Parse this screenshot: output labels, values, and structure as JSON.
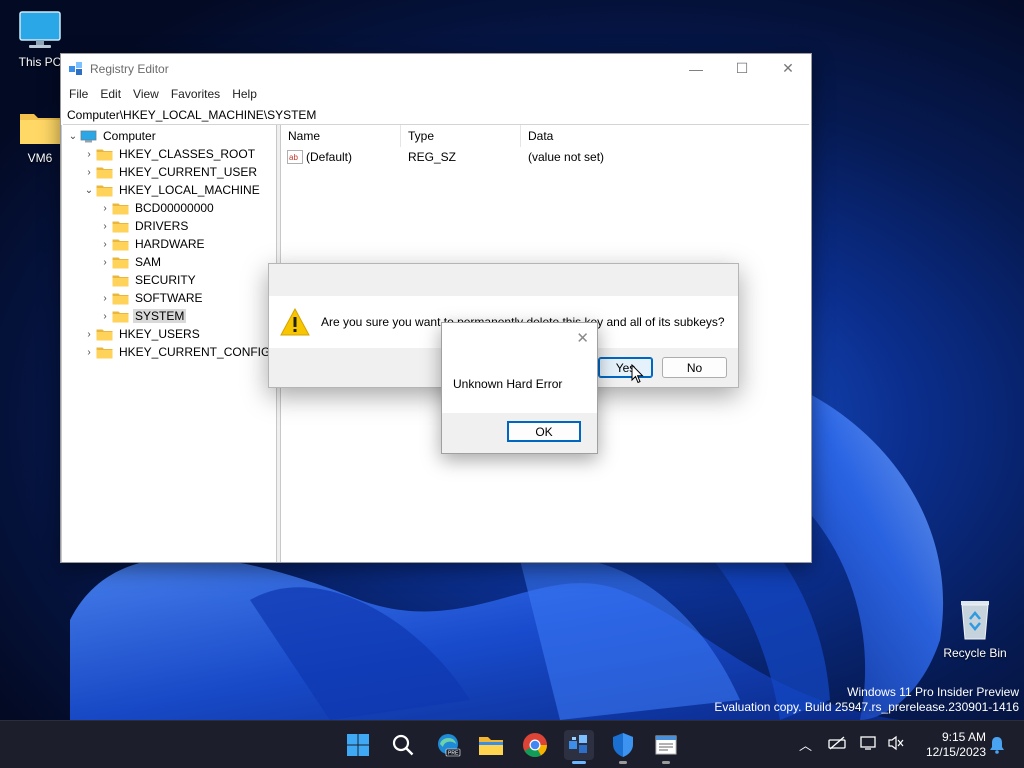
{
  "desktop": {
    "icons": [
      {
        "label": "This PC"
      },
      {
        "label": "VM6"
      },
      {
        "label": "Recycle Bin"
      }
    ],
    "watermark": {
      "line1": "Windows 11 Pro Insider Preview",
      "line2": "Evaluation copy. Build 25947.rs_prerelease.230901-1416"
    }
  },
  "regedit": {
    "title": "Registry Editor",
    "menu": [
      "File",
      "Edit",
      "View",
      "Favorites",
      "Help"
    ],
    "address": "Computer\\HKEY_LOCAL_MACHINE\\SYSTEM",
    "tree": [
      {
        "label": "Computer",
        "level": 0,
        "expand": "expanded",
        "icon": "computer"
      },
      {
        "label": "HKEY_CLASSES_ROOT",
        "level": 1,
        "expand": "collapsed"
      },
      {
        "label": "HKEY_CURRENT_USER",
        "level": 1,
        "expand": "collapsed"
      },
      {
        "label": "HKEY_LOCAL_MACHINE",
        "level": 1,
        "expand": "expanded"
      },
      {
        "label": "BCD00000000",
        "level": 2,
        "expand": "collapsed"
      },
      {
        "label": "DRIVERS",
        "level": 2,
        "expand": "collapsed"
      },
      {
        "label": "HARDWARE",
        "level": 2,
        "expand": "collapsed"
      },
      {
        "label": "SAM",
        "level": 2,
        "expand": "collapsed"
      },
      {
        "label": "SECURITY",
        "level": 2,
        "expand": "none"
      },
      {
        "label": "SOFTWARE",
        "level": 2,
        "expand": "collapsed"
      },
      {
        "label": "SYSTEM",
        "level": 2,
        "expand": "collapsed",
        "selected": true
      },
      {
        "label": "HKEY_USERS",
        "level": 1,
        "expand": "collapsed"
      },
      {
        "label": "HKEY_CURRENT_CONFIG",
        "level": 1,
        "expand": "collapsed"
      }
    ],
    "columns": [
      "Name",
      "Type",
      "Data"
    ],
    "rows": [
      {
        "name": "(Default)",
        "type": "REG_SZ",
        "data": "(value not set)"
      }
    ]
  },
  "confirm_dialog": {
    "message": "Are you sure you want to permanently delete this key and all of its subkeys?",
    "yes_label": "Yes",
    "no_label": "No"
  },
  "error_dialog": {
    "message": "Unknown Hard Error",
    "ok_label": "OK"
  },
  "taskbar": {
    "apps": [
      "start-icon",
      "search-icon",
      "edge-dev-icon",
      "file-explorer-icon",
      "chrome-icon",
      "regedit-icon",
      "security-icon",
      "notepad-icon"
    ],
    "time": "9:15 AM",
    "date": "12/15/2023",
    "accent": "#6cb6ff"
  }
}
